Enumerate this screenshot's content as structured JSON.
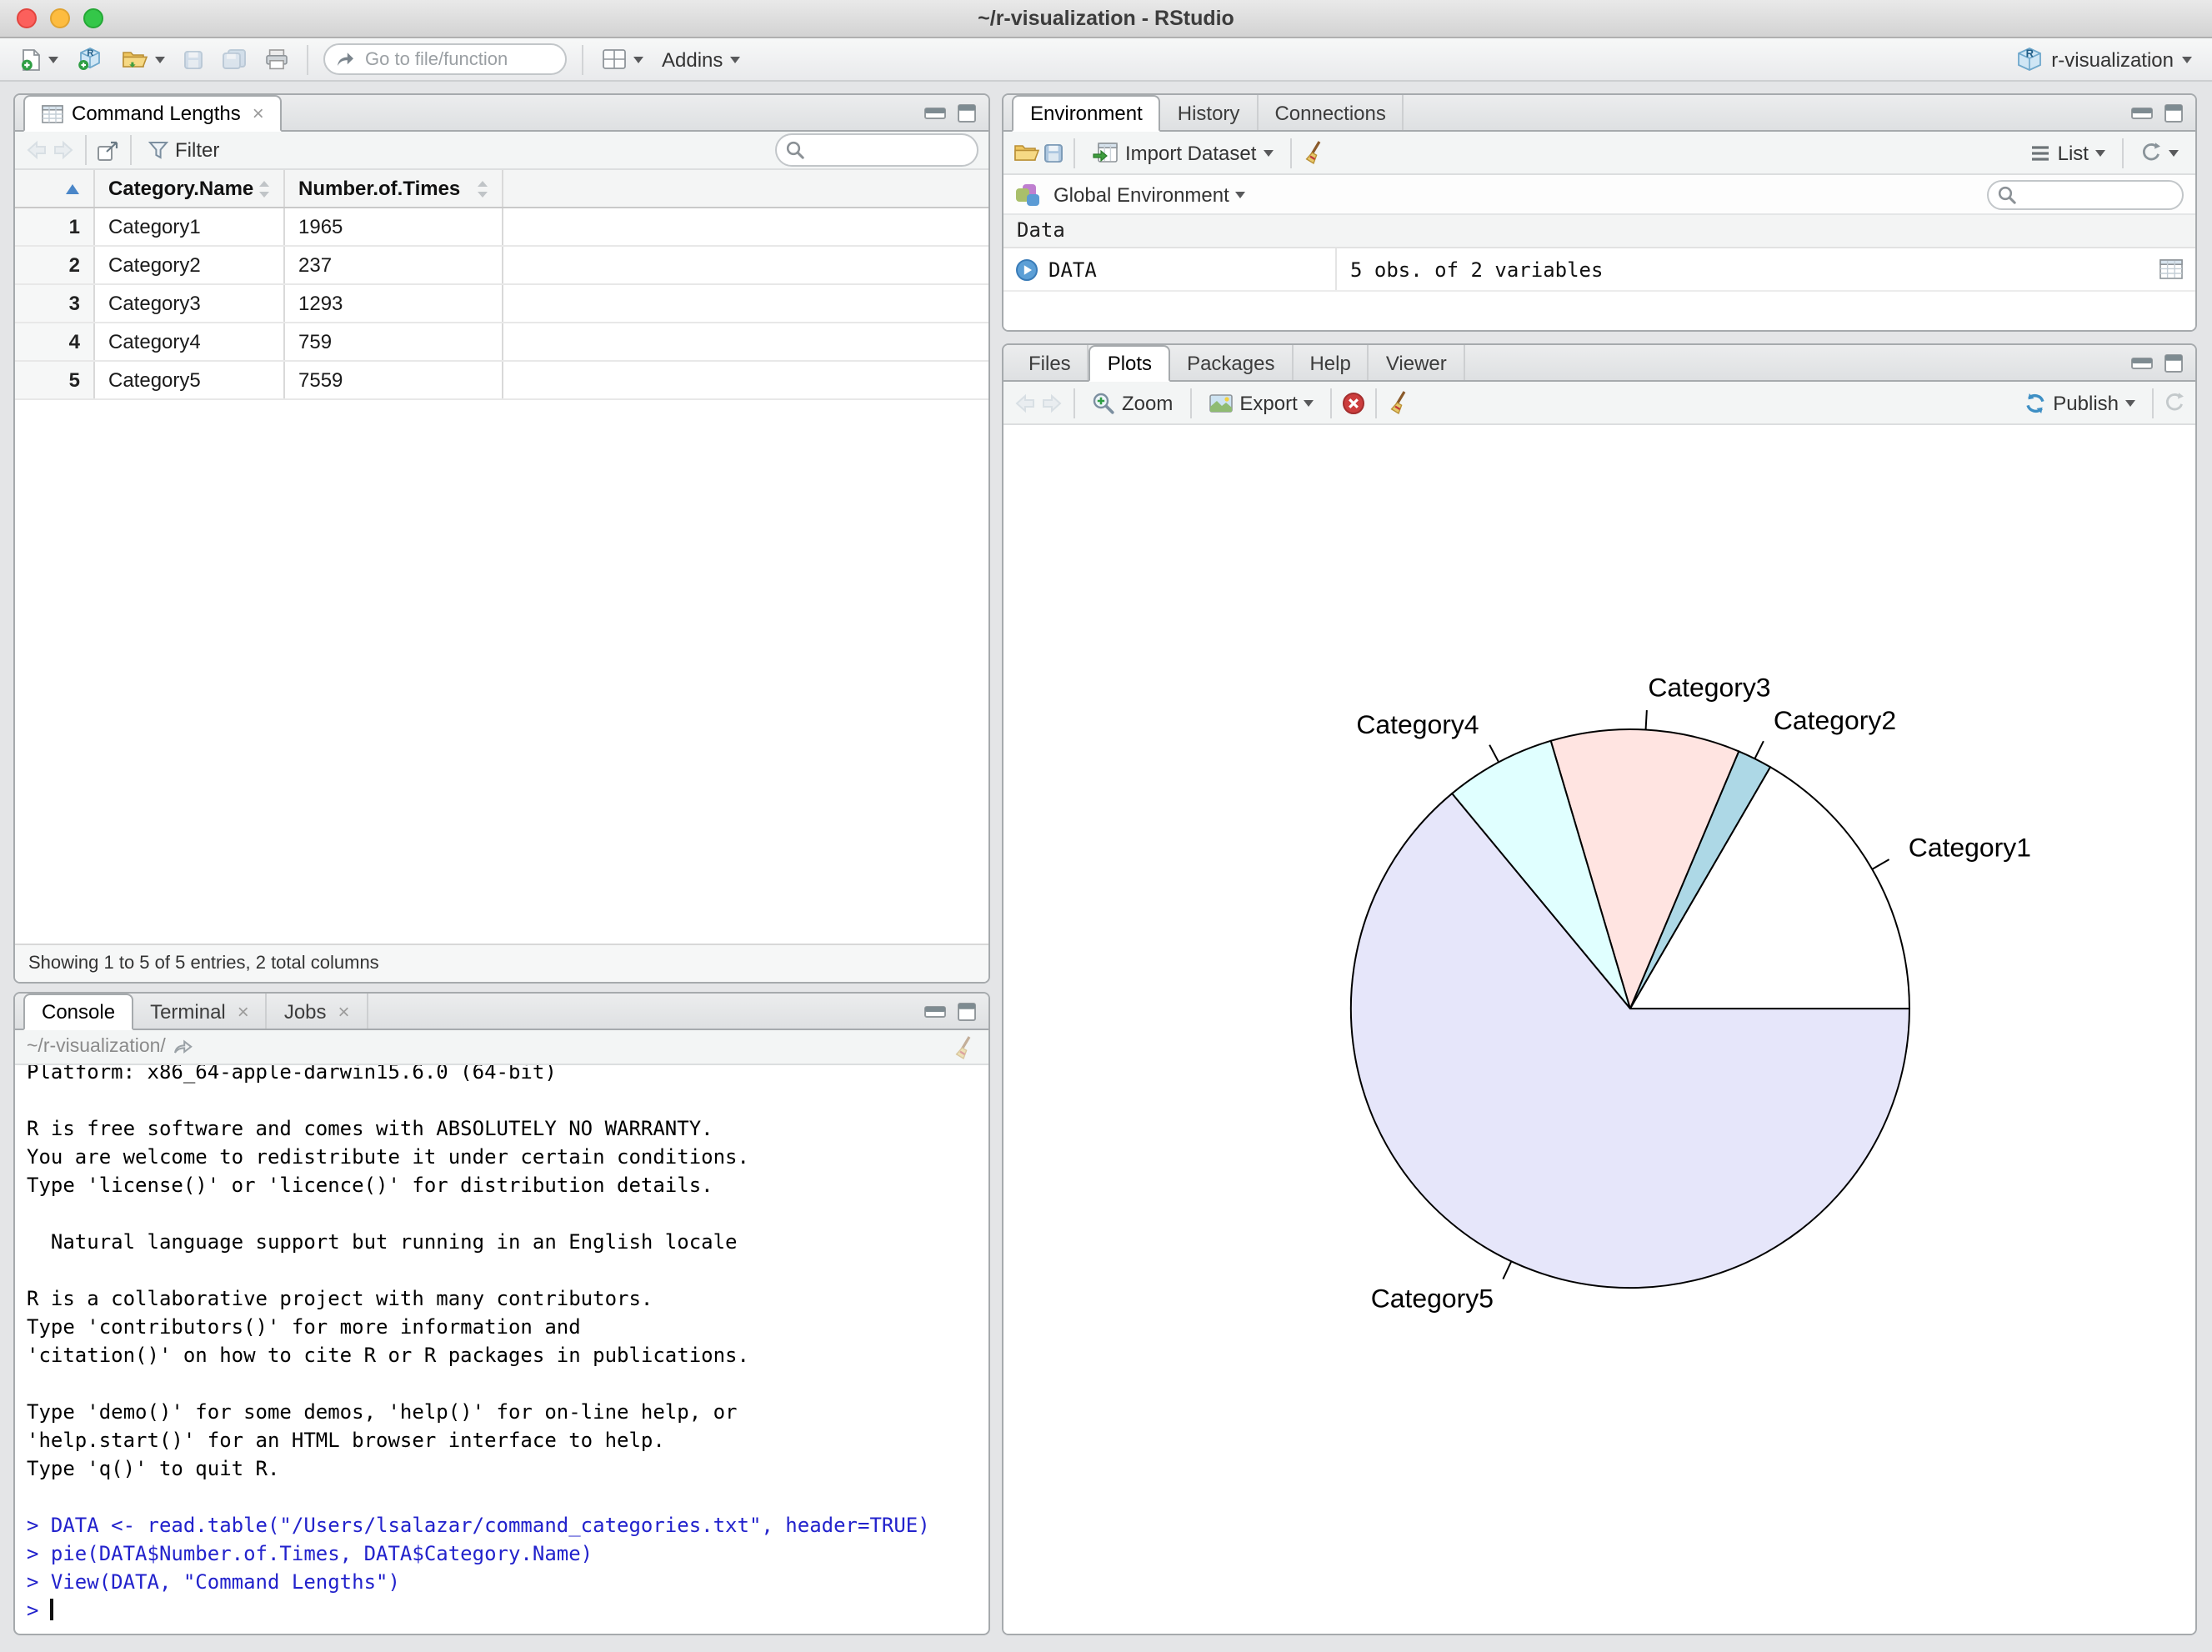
{
  "window": {
    "title": "~/r-visualization - RStudio"
  },
  "toolbar": {
    "goto_placeholder": "Go to file/function",
    "addins_label": "Addins",
    "project_label": "r-visualization"
  },
  "viewer": {
    "tab_label": "Command Lengths",
    "filter_label": "Filter",
    "table": {
      "columns": [
        "Category.Name",
        "Number.of.Times"
      ],
      "rows": [
        [
          "1",
          "Category1",
          "1965"
        ],
        [
          "2",
          "Category2",
          "237"
        ],
        [
          "3",
          "Category3",
          "1293"
        ],
        [
          "4",
          "Category4",
          "759"
        ],
        [
          "5",
          "Category5",
          "7559"
        ]
      ]
    },
    "footer": "Showing 1 to 5 of 5 entries, 2 total columns"
  },
  "environment": {
    "tabs": [
      "Environment",
      "History",
      "Connections"
    ],
    "active_tab": "Environment",
    "import_label": "Import Dataset",
    "list_label": "List",
    "scope_label": "Global Environment",
    "section_label": "Data",
    "objects": [
      {
        "name": "DATA",
        "value": "5 obs. of 2 variables"
      }
    ]
  },
  "plots": {
    "tabs": [
      "Files",
      "Plots",
      "Packages",
      "Help",
      "Viewer"
    ],
    "active_tab": "Plots",
    "zoom_label": "Zoom",
    "export_label": "Export",
    "publish_label": "Publish"
  },
  "console": {
    "tabs": [
      "Console",
      "Terminal",
      "Jobs"
    ],
    "active_tab": "Console",
    "path": "~/r-visualization/",
    "input_color": "#2222CC",
    "lines": [
      {
        "type": "output",
        "text": "Platform: x86_64-apple-darwin15.6.0 (64-bit)"
      },
      {
        "type": "output",
        "text": ""
      },
      {
        "type": "output",
        "text": "R is free software and comes with ABSOLUTELY NO WARRANTY."
      },
      {
        "type": "output",
        "text": "You are welcome to redistribute it under certain conditions."
      },
      {
        "type": "output",
        "text": "Type 'license()' or 'licence()' for distribution details."
      },
      {
        "type": "output",
        "text": ""
      },
      {
        "type": "output",
        "text": "  Natural language support but running in an English locale"
      },
      {
        "type": "output",
        "text": ""
      },
      {
        "type": "output",
        "text": "R is a collaborative project with many contributors."
      },
      {
        "type": "output",
        "text": "Type 'contributors()' for more information and"
      },
      {
        "type": "output",
        "text": "'citation()' on how to cite R or R packages in publications."
      },
      {
        "type": "output",
        "text": ""
      },
      {
        "type": "output",
        "text": "Type 'demo()' for some demos, 'help()' for on-line help, or"
      },
      {
        "type": "output",
        "text": "'help.start()' for an HTML browser interface to help."
      },
      {
        "type": "output",
        "text": "Type 'q()' to quit R."
      },
      {
        "type": "output",
        "text": ""
      },
      {
        "type": "input",
        "text": "> DATA <- read.table(\"/Users/lsalazar/command_categories.txt\", header=TRUE)"
      },
      {
        "type": "input",
        "text": "> pie(DATA$Number.of.Times, DATA$Category.Name)"
      },
      {
        "type": "input",
        "text": "> View(DATA, \"Command Lengths\")"
      },
      {
        "type": "input",
        "text": "> ",
        "cursor": true
      }
    ]
  },
  "chart_data": {
    "type": "pie",
    "title": "",
    "categories": [
      "Category1",
      "Category2",
      "Category3",
      "Category4",
      "Category5"
    ],
    "values": [
      1965,
      237,
      1293,
      759,
      7559
    ],
    "colors": [
      "#FFFFFF",
      "#ADD8E6",
      "#FFE4E1",
      "#E0FFFF",
      "#E6E6FA"
    ],
    "start_angle_deg": 0,
    "direction": "counterclockwise",
    "stroke_color": "#000000",
    "label_color": "#000000",
    "legend": "none"
  }
}
